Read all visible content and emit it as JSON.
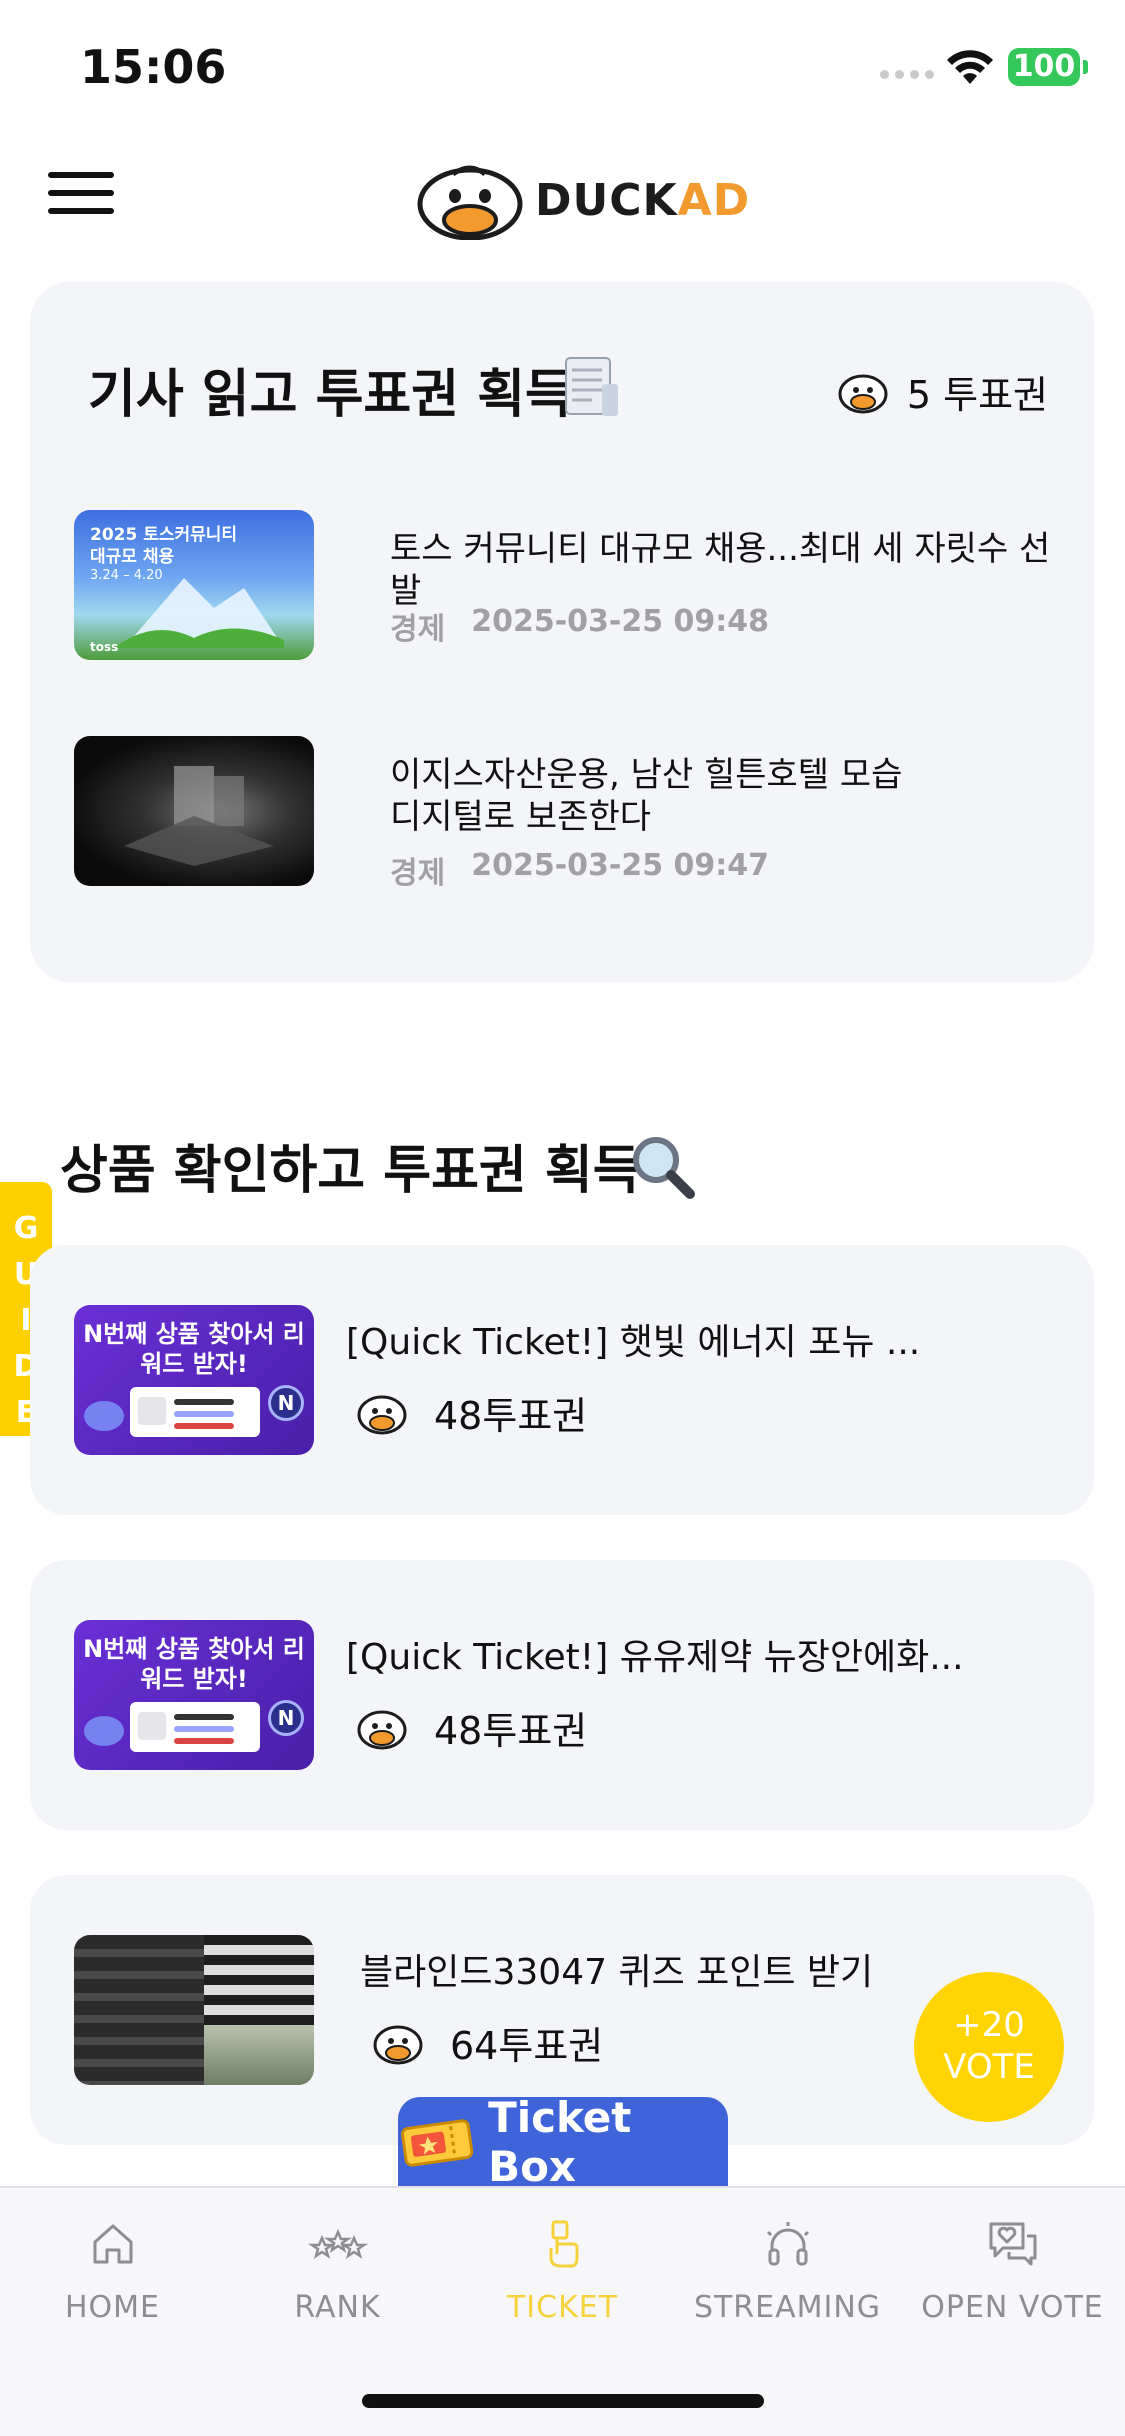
{
  "status_bar": {
    "time": "15:06",
    "battery": "100"
  },
  "header": {
    "logo_part1": "DUCK",
    "logo_part2": "AD"
  },
  "articles_section": {
    "title": "기사 읽고 투표권 획득",
    "reward": "5 투표권",
    "items": [
      {
        "title": "토스 커뮤니티 대규모 채용...최대 세 자릿수 선발",
        "category": "경제",
        "date": "2025-03-25 09:48",
        "thumb_line1": "2025 토스커뮤니티",
        "thumb_line2": "대규모 채용",
        "thumb_dates": "3.24 – 4.20",
        "thumb_brand": "toss"
      },
      {
        "title_line1": "이지스자산운용, 남산 힐튼호텔 모습",
        "title_line2": "디지털로 보존한다",
        "category": "경제",
        "date": "2025-03-25 09:47"
      }
    ]
  },
  "products_section": {
    "title": "상품 확인하고 투표권 획득",
    "items": [
      {
        "title": "[Quick Ticket!] 햇빛 에너지 포뉴 ...",
        "reward": "48투표권",
        "thumb_text": "N번째 상품 찾아서 리워드 받자!"
      },
      {
        "title": "[Quick Ticket!] 유유제약 뉴장안에화...",
        "reward": "48투표권",
        "thumb_text": "N번째 상품 찾아서 리워드 받자!"
      },
      {
        "title": "블라인드33047 퀴즈 포인트 받기",
        "reward": "64투표권"
      }
    ]
  },
  "guide_tab": {
    "label": "GUIDE"
  },
  "vote_fab": {
    "line1": "+20",
    "line2": "VOTE"
  },
  "ticket_box": {
    "label": "Ticket Box"
  },
  "tabbar": {
    "items": [
      {
        "label": "HOME",
        "icon": "home-icon"
      },
      {
        "label": "RANK",
        "icon": "stars-icon"
      },
      {
        "label": "TICKET",
        "icon": "ticket-hand-icon",
        "active": true
      },
      {
        "label": "STREAMING",
        "icon": "headphones-icon"
      },
      {
        "label": "OPEN VOTE",
        "icon": "chat-heart-icon"
      }
    ]
  },
  "colors": {
    "accent_yellow": "#FFD400",
    "ticket_blue": "#3F63D8",
    "card_bg": "#F4F5F8",
    "logo_orange": "#F29A2E"
  }
}
